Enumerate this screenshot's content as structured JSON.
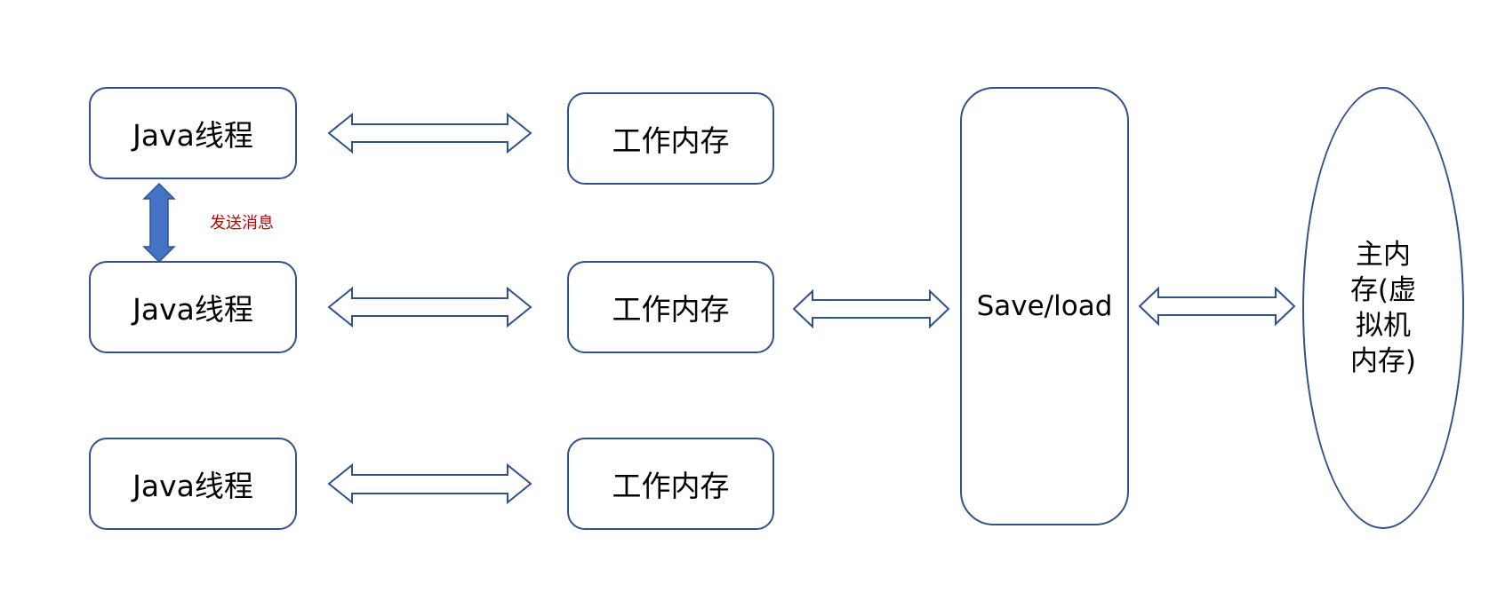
{
  "diagram": {
    "threads": [
      "Java线程",
      "Java线程",
      "Java线程"
    ],
    "working_memory": [
      "工作内存",
      "工作内存",
      "工作内存"
    ],
    "save_load": "Save/load",
    "main_memory": "主内存(虚拟机内存)",
    "send_message": "发送消息"
  },
  "colors": {
    "outline": "#2F528F",
    "solid_arrow": "#4472C4",
    "label_red": "#C00000"
  }
}
